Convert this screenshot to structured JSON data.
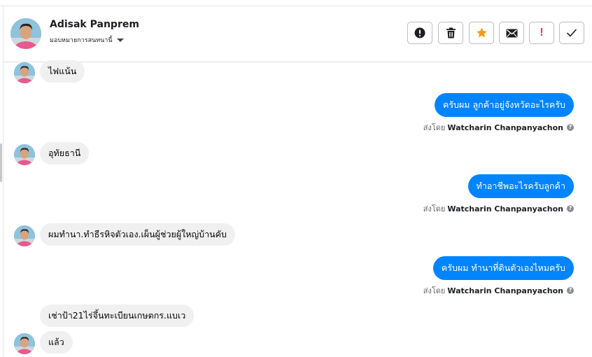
{
  "header": {
    "contact_name": "Adisak Panprem",
    "assign_label": "มอบหมายการสนทนานี้"
  },
  "toolbar": {
    "icons": [
      "alert-circle-icon",
      "trash-icon",
      "star-icon",
      "mail-icon",
      "exclamation-icon",
      "checkmark-icon"
    ],
    "exclamation_label": "!",
    "accent_star": "#f39c12",
    "accent_spam": "#e53935"
  },
  "messages": {
    "m1_text": "ไฟแน้น",
    "m2_text": "ครับผม ลูกค้าอยู่จังหวัดอะไรครับ",
    "m3_text": "อุทัยธานี",
    "m4_text": "ทำอาชีพอะไรครับลูกค้า",
    "m5_text": "ผมทำนา.ทำธีรหิจตัวเอง.เผ็นผู้ช่วยผู้ใหญ่บ้านคับ",
    "m6_text": "ครับผม ทำนาที่ดินตัวเองไหมครับ",
    "m7_text": "เช่าป้า21ไร่จึ้นทะเบียนเกษตกร.แบเว",
    "m8_text": "แล้ว"
  },
  "sent_by": {
    "prefix": "ส่งโดย",
    "agent_name": "Watcharin Chanpanyachon",
    "help_mark": "?"
  },
  "colors": {
    "outgoing_bubble": "#0084ff",
    "incoming_bubble": "#f0f0f0"
  }
}
